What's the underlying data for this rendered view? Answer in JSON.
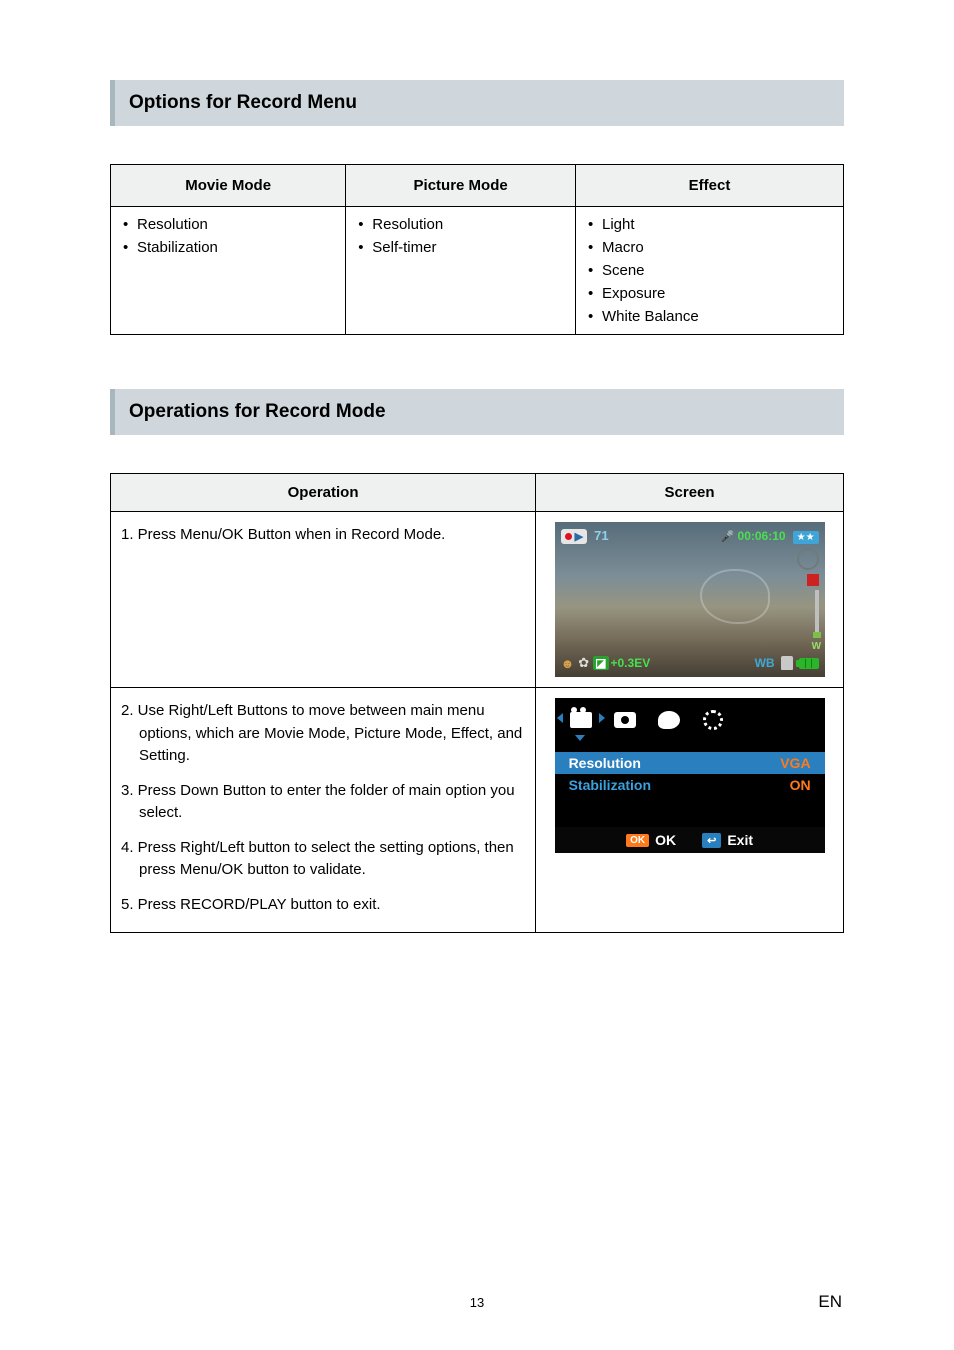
{
  "section1_title": "Options for Record Menu",
  "section2_title": "Operations for Record Mode",
  "options_table": {
    "headers": [
      "Movie Mode",
      "Picture Mode",
      "Effect"
    ],
    "cols": [
      [
        "Resolution",
        "Stabilization"
      ],
      [
        "Resolution",
        "Self-timer"
      ],
      [
        "Light",
        "Macro",
        "Scene",
        "Exposure",
        "White Balance"
      ]
    ]
  },
  "ops_table": {
    "headers": [
      "Operation",
      "Screen"
    ],
    "row1": {
      "steps": [
        "1. Press Menu/OK Button when in Record Mode."
      ]
    },
    "row2": {
      "steps": [
        "2. Use Right/Left Buttons to move between main menu options, which are Movie Mode, Picture Mode, Effect, and Setting.",
        "3. Press Down Button to enter the folder of main option you select.",
        "4. Press Right/Left button to select the setting options, then press Menu/OK button to validate.",
        "5. Press RECORD/PLAY button to exit."
      ]
    }
  },
  "screen1": {
    "shots": "71",
    "time": "00:06:10",
    "ev": "+0.3EV",
    "wb": "WB",
    "zoom_w": "W"
  },
  "screen2": {
    "menu": [
      {
        "label": "Resolution",
        "value": "VGA"
      },
      {
        "label": "Stabilization",
        "value": "ON"
      }
    ],
    "ok_label": "OK",
    "ok_chip": "OK",
    "exit_label": "Exit"
  },
  "page_number": "13",
  "lang": "EN"
}
